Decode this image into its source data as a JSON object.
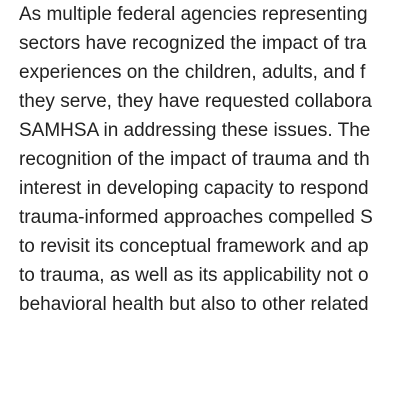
{
  "document": {
    "paragraph_lines": [
      "As multiple federal agencies representing",
      "sectors have recognized the impact of tra",
      "experiences on the children, adults, and f",
      "they serve, they have requested collabora",
      "SAMHSA in addressing these issues. The",
      "recognition of the impact of trauma and th",
      "interest in developing capacity to respond",
      "trauma-informed approaches compelled S",
      "to revisit its conceptual framework and ap",
      "to trauma, as well as its applicability not o",
      "behavioral health but also to other related"
    ]
  }
}
